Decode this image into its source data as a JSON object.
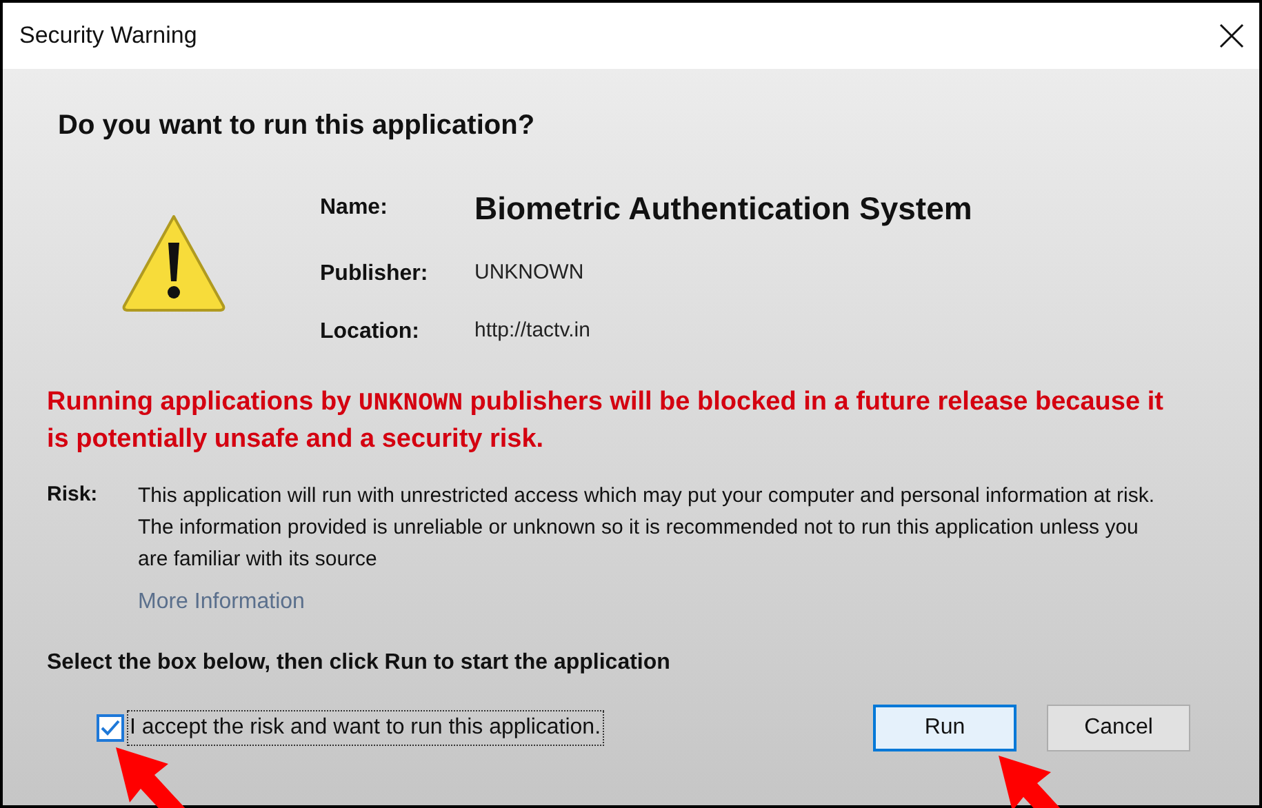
{
  "window": {
    "title": "Security Warning"
  },
  "heading": "Do you want to run this application?",
  "details": [
    {
      "label": "Name:",
      "value": "Biometric Authentication System",
      "kind": "title"
    },
    {
      "label": "Publisher:",
      "value": "UNKNOWN",
      "kind": "plain"
    },
    {
      "label": "Location:",
      "value": "http://tactv.in",
      "kind": "plain"
    }
  ],
  "warning": {
    "before": "Running applications by ",
    "emphasis": "UNKNOWN",
    "after": " publishers will be blocked in a future release because it is potentially unsafe and a security risk."
  },
  "risk": {
    "label": "Risk:",
    "text": "This application will run with unrestricted access which may put your computer and personal information at risk. The information provided is unreliable or unknown so it is recommended not to run this application unless you are familiar with its source",
    "link": "More Information"
  },
  "instruction": "Select the box below, then click Run to start the application",
  "accept": {
    "label": "I accept the risk and want to run this application.",
    "checked": true
  },
  "buttons": [
    {
      "label": "Run",
      "selected": true
    },
    {
      "label": "Cancel",
      "selected": false
    }
  ]
}
